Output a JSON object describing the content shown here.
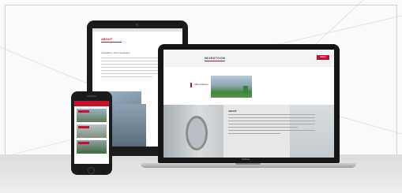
{
  "tablet": {
    "page_title": "ABOUT",
    "subheading": "Investition / Kommunikation"
  },
  "laptop": {
    "logo": "INVESTOON",
    "menu_label": "MENU",
    "section_label": "Uber Investoon",
    "text_title": "ABOUT",
    "brand": "MacBook"
  },
  "colors": {
    "accent": "#c8102e",
    "device_body": "#1b1b1b"
  }
}
